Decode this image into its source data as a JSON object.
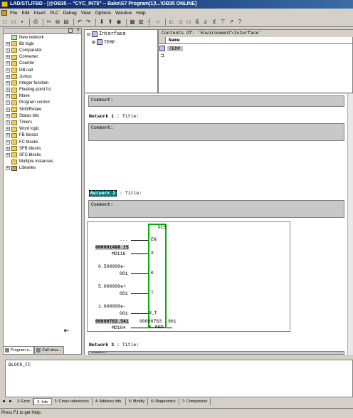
{
  "window": {
    "title": "LAD/STL/FBD - [@OB35 -- \"CYC_INT5\" -- Bake\\S7 Program(1)\\...\\OB35 ONLINE]"
  },
  "menu": [
    "File",
    "Edit",
    "Insert",
    "PLC",
    "Debug",
    "View",
    "Options",
    "Window",
    "Help"
  ],
  "toolbar_icons": [
    "new-icon",
    "open-icon",
    "save-icon",
    "print-icon",
    "cut-icon",
    "copy-icon",
    "paste-icon",
    "monitor-icon",
    "download-icon",
    "run-icon",
    "stop-icon",
    "help-icon"
  ],
  "left_panel": {
    "items": [
      {
        "label": "New network",
        "expand": false,
        "icon": "net"
      },
      {
        "label": "Bit logic",
        "expand": true
      },
      {
        "label": "Comparator",
        "expand": true
      },
      {
        "label": "Converter",
        "expand": true
      },
      {
        "label": "Counter",
        "expand": true
      },
      {
        "label": "DB call",
        "expand": true
      },
      {
        "label": "Jumps",
        "expand": true
      },
      {
        "label": "Integer function",
        "expand": true
      },
      {
        "label": "Floating-point fct.",
        "expand": true
      },
      {
        "label": "Move",
        "expand": true
      },
      {
        "label": "Program control",
        "expand": true
      },
      {
        "label": "Shift/Rotate",
        "expand": true
      },
      {
        "label": "Status bits",
        "expand": true
      },
      {
        "label": "Timers",
        "expand": true
      },
      {
        "label": "Word logic",
        "expand": true
      },
      {
        "label": "FB blocks",
        "expand": true
      },
      {
        "label": "FC blocks",
        "expand": true
      },
      {
        "label": "SFB blocks",
        "expand": true
      },
      {
        "label": "SFC blocks",
        "expand": true
      },
      {
        "label": "Multiple instances",
        "expand": false
      },
      {
        "label": "Libraries",
        "expand": true,
        "icon": "lib"
      }
    ],
    "tabs": [
      {
        "label": "Program e..."
      },
      {
        "label": "Call struc..."
      }
    ]
  },
  "interface": {
    "root": "Interface",
    "child": "TEMP",
    "contents_of": "Contents Of: 'Environment\\Interface'",
    "column_name": "Name",
    "row": "TEMP"
  },
  "editor": {
    "comment_label": "Comment:",
    "network1": {
      "label": "Network 1",
      "title": ": Title:"
    },
    "network2": {
      "label": "Network 2",
      "title": ": Title:"
    },
    "network3": {
      "label": "Network 3",
      "title": ": Title:"
    },
    "fbd": {
      "block_name": "FC5",
      "en_input": "...",
      "x_value": "000001498.15",
      "x_addr": "MD116",
      "k_line1": "6.500000e-",
      "k_line2": "001",
      "t_line1": "5.000000e+",
      "t_line2": "001",
      "dt_line1": "1.000000e-",
      "dt_line2": "001",
      "y_value": "00000763.541",
      "y_addr": "MD104",
      "out_value": "00000763",
      "out_suffix": "961",
      "pins": {
        "en": "EN",
        "x": "X",
        "k": "K",
        "t": "T",
        "dt": "d_t",
        "y": "Y",
        "eno": "ENO"
      }
    }
  },
  "block_pane": {
    "text": "BLOCK_FC"
  },
  "bottom_tabs": [
    "1: Error",
    "2: Info",
    "3: Cross-references",
    "4: Address info.",
    "5: Modify",
    "6: Diagnostics",
    "7: Comparison"
  ],
  "status": "Press F1 to get Help."
}
